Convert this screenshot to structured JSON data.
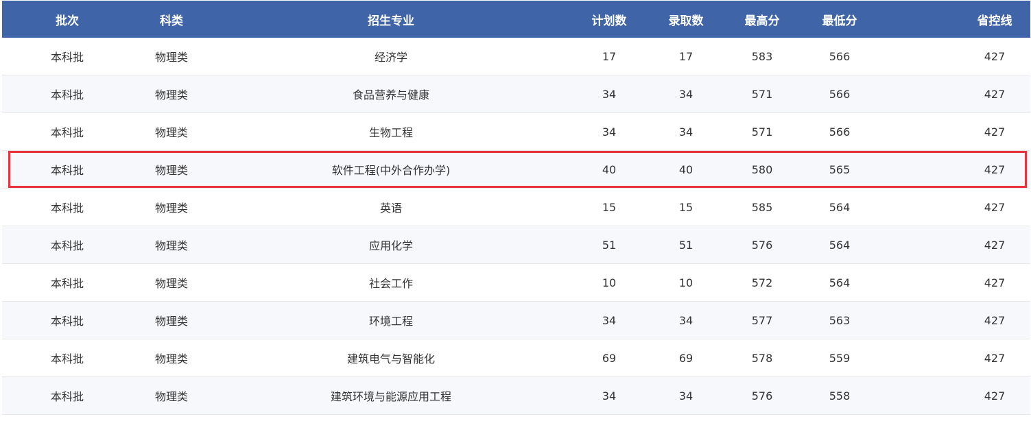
{
  "headers": [
    "批次",
    "科类",
    "招生专业",
    "计划数",
    "录取数",
    "最高分",
    "最低分",
    "省控线"
  ],
  "rows": [
    [
      "本科批",
      "物理类",
      "经济学",
      "17",
      "17",
      "583",
      "566",
      "427"
    ],
    [
      "本科批",
      "物理类",
      "食品营养与健康",
      "34",
      "34",
      "571",
      "566",
      "427"
    ],
    [
      "本科批",
      "物理类",
      "生物工程",
      "34",
      "34",
      "571",
      "566",
      "427"
    ],
    [
      "本科批",
      "物理类",
      "软件工程(中外合作办学)",
      "40",
      "40",
      "580",
      "565",
      "427"
    ],
    [
      "本科批",
      "物理类",
      "英语",
      "15",
      "15",
      "585",
      "564",
      "427"
    ],
    [
      "本科批",
      "物理类",
      "应用化学",
      "51",
      "51",
      "576",
      "564",
      "427"
    ],
    [
      "本科批",
      "物理类",
      "社会工作",
      "10",
      "10",
      "572",
      "564",
      "427"
    ],
    [
      "本科批",
      "物理类",
      "环境工程",
      "34",
      "34",
      "577",
      "563",
      "427"
    ],
    [
      "本科批",
      "物理类",
      "建筑电气与智能化",
      "69",
      "69",
      "578",
      "559",
      "427"
    ],
    [
      "本科批",
      "物理类",
      "建筑环境与能源应用工程",
      "34",
      "34",
      "576",
      "558",
      "427"
    ]
  ],
  "highlighted_row_index": 3,
  "colors": {
    "header_bg": "#3f64a8",
    "header_text": "#ffffff",
    "highlight_border": "#e8323c",
    "alt_row_bg": "#f7f8fb"
  }
}
